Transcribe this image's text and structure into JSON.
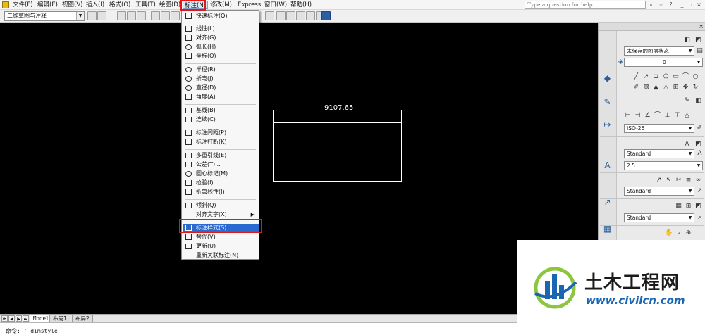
{
  "menubar": {
    "items": [
      "文件(F)",
      "编辑(E)",
      "视图(V)",
      "插入(I)",
      "格式(O)",
      "工具(T)",
      "绘图(D)",
      "标注(N)",
      "修改(M)",
      "Express",
      "窗口(W)",
      "帮助(H)"
    ],
    "active_index": 7,
    "help_placeholder": "Type a question for help"
  },
  "toolbar": {
    "workspace": "二维草图与注释"
  },
  "canvas": {
    "dimension_value": "9107.65"
  },
  "dim_menu": {
    "items": [
      {
        "label": "快速标注(Q)"
      },
      {
        "label": "线性(L)"
      },
      {
        "label": "对齐(G)"
      },
      {
        "label": "弧长(H)"
      },
      {
        "label": "坐标(O)"
      },
      {
        "label": "半径(R)"
      },
      {
        "label": "折弯(J)"
      },
      {
        "label": "直径(D)"
      },
      {
        "label": "角度(A)"
      },
      {
        "label": "基线(B)"
      },
      {
        "label": "连续(C)"
      },
      {
        "label": "标注间距(P)"
      },
      {
        "label": "标注打断(K)"
      },
      {
        "label": "多重引线(E)"
      },
      {
        "label": "公差(T)..."
      },
      {
        "label": "圆心标记(M)"
      },
      {
        "label": "检验(I)"
      },
      {
        "label": "折弯线性(J)"
      },
      {
        "label": "倾斜(Q)"
      },
      {
        "label": "对齐文字(X)"
      },
      {
        "label": "标注样式(S)..."
      },
      {
        "label": "替代(V)"
      },
      {
        "label": "更新(U)"
      },
      {
        "label": "重新关联标注(N)"
      }
    ],
    "highlighted_index": 20
  },
  "palette": {
    "layer_state": "未保存的图层状态",
    "layer_current": "0",
    "dim_style": "ISO-25",
    "text_style": "Standard",
    "text_height": "2.5",
    "mleader_style": "Standard",
    "table_style": "Standard"
  },
  "tabs": [
    "Model",
    "布局1",
    "布局2"
  ],
  "command": {
    "text": "命令: '_dimstyle"
  },
  "watermark": {
    "title": "土木工程网",
    "url": "www.civilcn.com"
  },
  "colors": {
    "canvas_bg": "#000000",
    "highlight": "#2a6ad0",
    "red_box": "#e01818",
    "watermark_blue": "#1a66b3"
  }
}
